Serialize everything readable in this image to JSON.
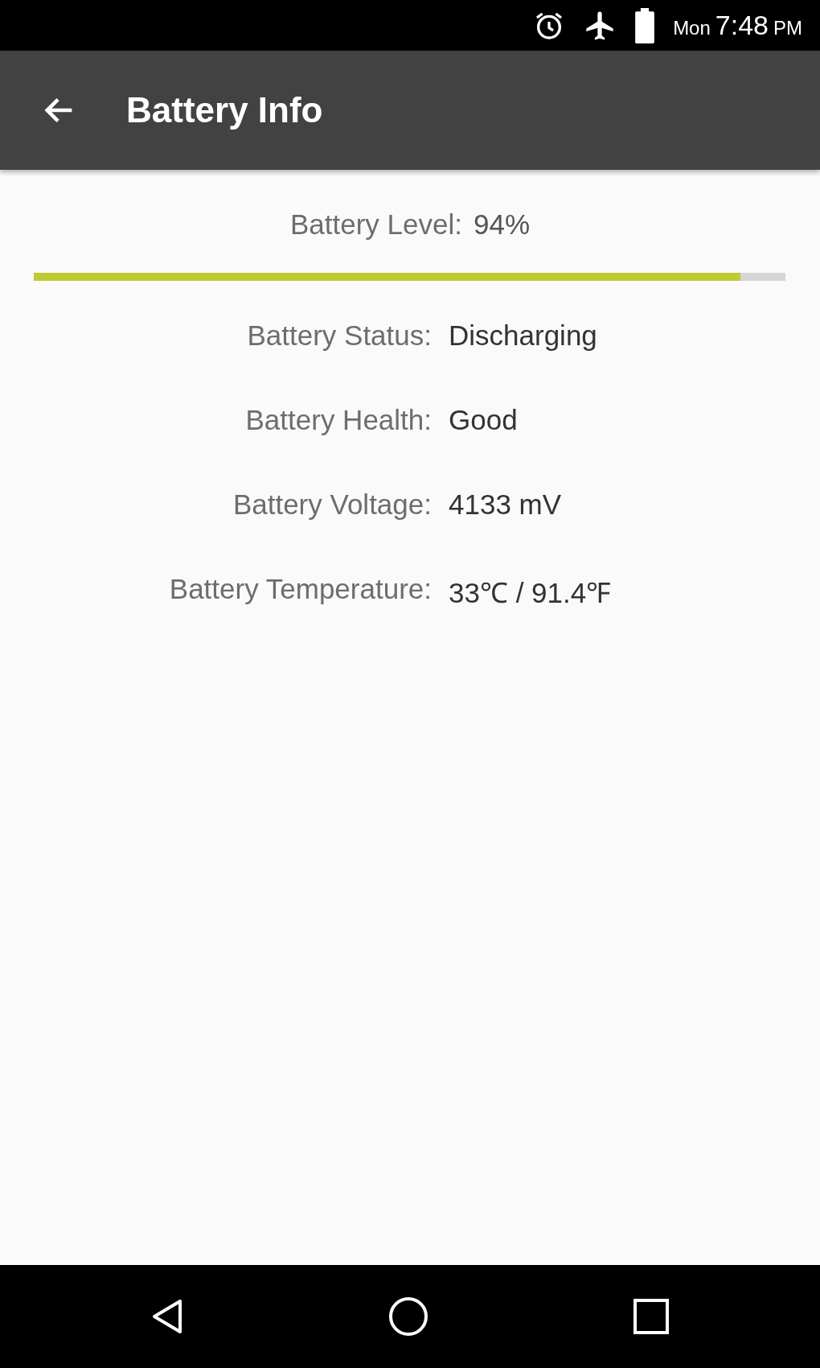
{
  "status_bar": {
    "day": "Mon",
    "time": "7:48",
    "period": "PM"
  },
  "app_bar": {
    "title": "Battery Info"
  },
  "battery_level": {
    "label": "Battery Level:",
    "value": "94%",
    "level": 0.94
  },
  "details": [
    {
      "label": "Battery Status:",
      "value": "Discharging"
    },
    {
      "label": "Battery Health:",
      "value": "Good"
    },
    {
      "label": "Battery Voltage:",
      "value": "4133 mV"
    },
    {
      "label": "Battery Temperature:",
      "value": "33℃ / 91.4℉"
    }
  ]
}
